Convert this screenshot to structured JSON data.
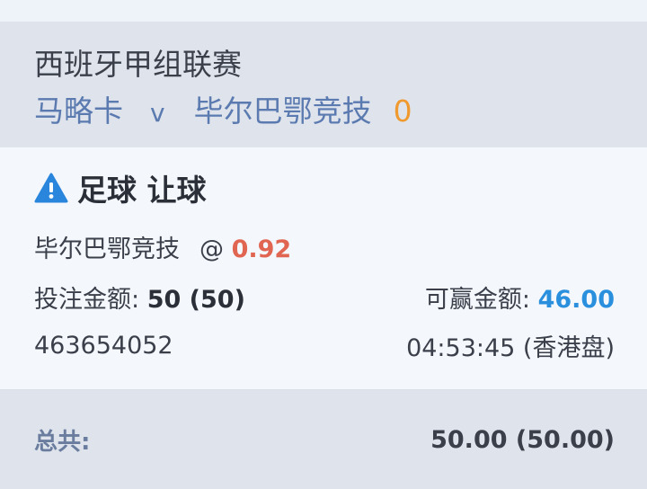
{
  "match": {
    "league": "西班牙甲组联赛",
    "home_team": "马略卡",
    "vs": "v",
    "away_team": "毕尔巴鄂竞技",
    "score": "0"
  },
  "bet": {
    "market": "足球 让球",
    "selection": "毕尔巴鄂竞技",
    "at_symbol": "@",
    "odds": "0.92",
    "stake_label": "投注金额:",
    "stake_value": "50 (50)",
    "win_label": "可赢金额:",
    "win_value": "46.00",
    "bet_id": "463654052",
    "time_odds_type": "04:53:45 (香港盘)"
  },
  "total": {
    "label": "总共:",
    "value": "50.00 (50.00)"
  },
  "colors": {
    "team_link": "#5b7ab0",
    "score": "#f0992e",
    "odds": "#e16652",
    "win": "#2a90de",
    "warning": "#2a86dc"
  },
  "icons": {
    "market_icon": "warning-triangle-icon"
  }
}
